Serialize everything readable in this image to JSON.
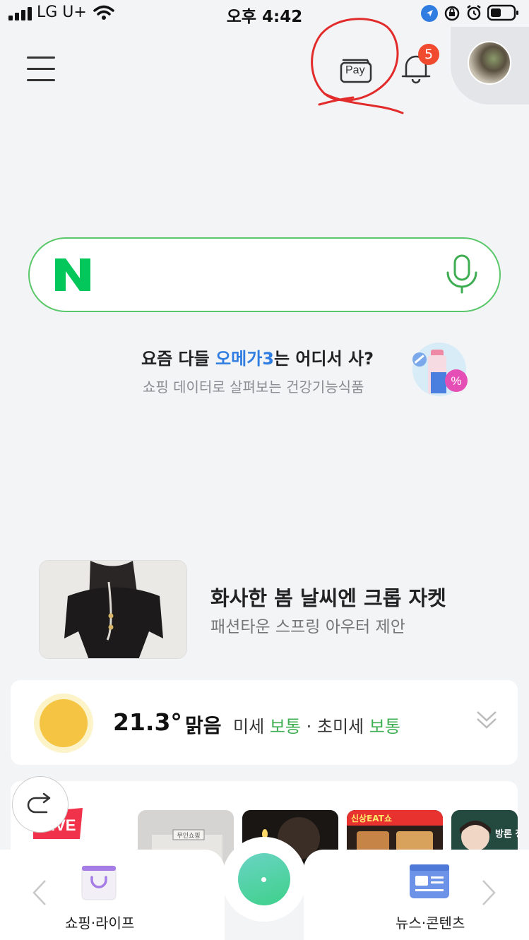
{
  "status_bar": {
    "carrier": "LG U+",
    "time": "오후 4:42"
  },
  "header": {
    "pay_label": "Pay",
    "notification_count": "5"
  },
  "search": {
    "logo": "N"
  },
  "promo_health": {
    "title_before": "요즘 다들 ",
    "title_highlight": "오메가3",
    "title_after": "는 어디서 사?",
    "subtitle": "쇼핑 데이터로 살펴보는 건강기능식품",
    "badge_symbol": "%"
  },
  "promo_fashion": {
    "title": "화사한 봄 날씨엔 크롭 자켓",
    "subtitle": "패션타운 스프링 아우터 제안"
  },
  "weather": {
    "temperature": "21.3°",
    "condition": "맑음",
    "fine_dust_label": "미세",
    "fine_dust_value": "보통",
    "separator": " · ",
    "ultra_fine_dust_label": "초미세",
    "ultra_fine_dust_value": "보통"
  },
  "feed": {
    "live_label": "LIVE",
    "thumb_labels": [
      "무인쇼핑",
      "",
      "신상EAT쇼",
      "방론 정정"
    ]
  },
  "bottom_nav": {
    "left_label": "쇼핑·라이프",
    "right_label": "뉴스·콘텐츠"
  },
  "colors": {
    "naver_green": "#03c75a",
    "badge_red": "#f04b2f",
    "link_blue": "#2f7de1",
    "status_green": "#3fae53"
  }
}
